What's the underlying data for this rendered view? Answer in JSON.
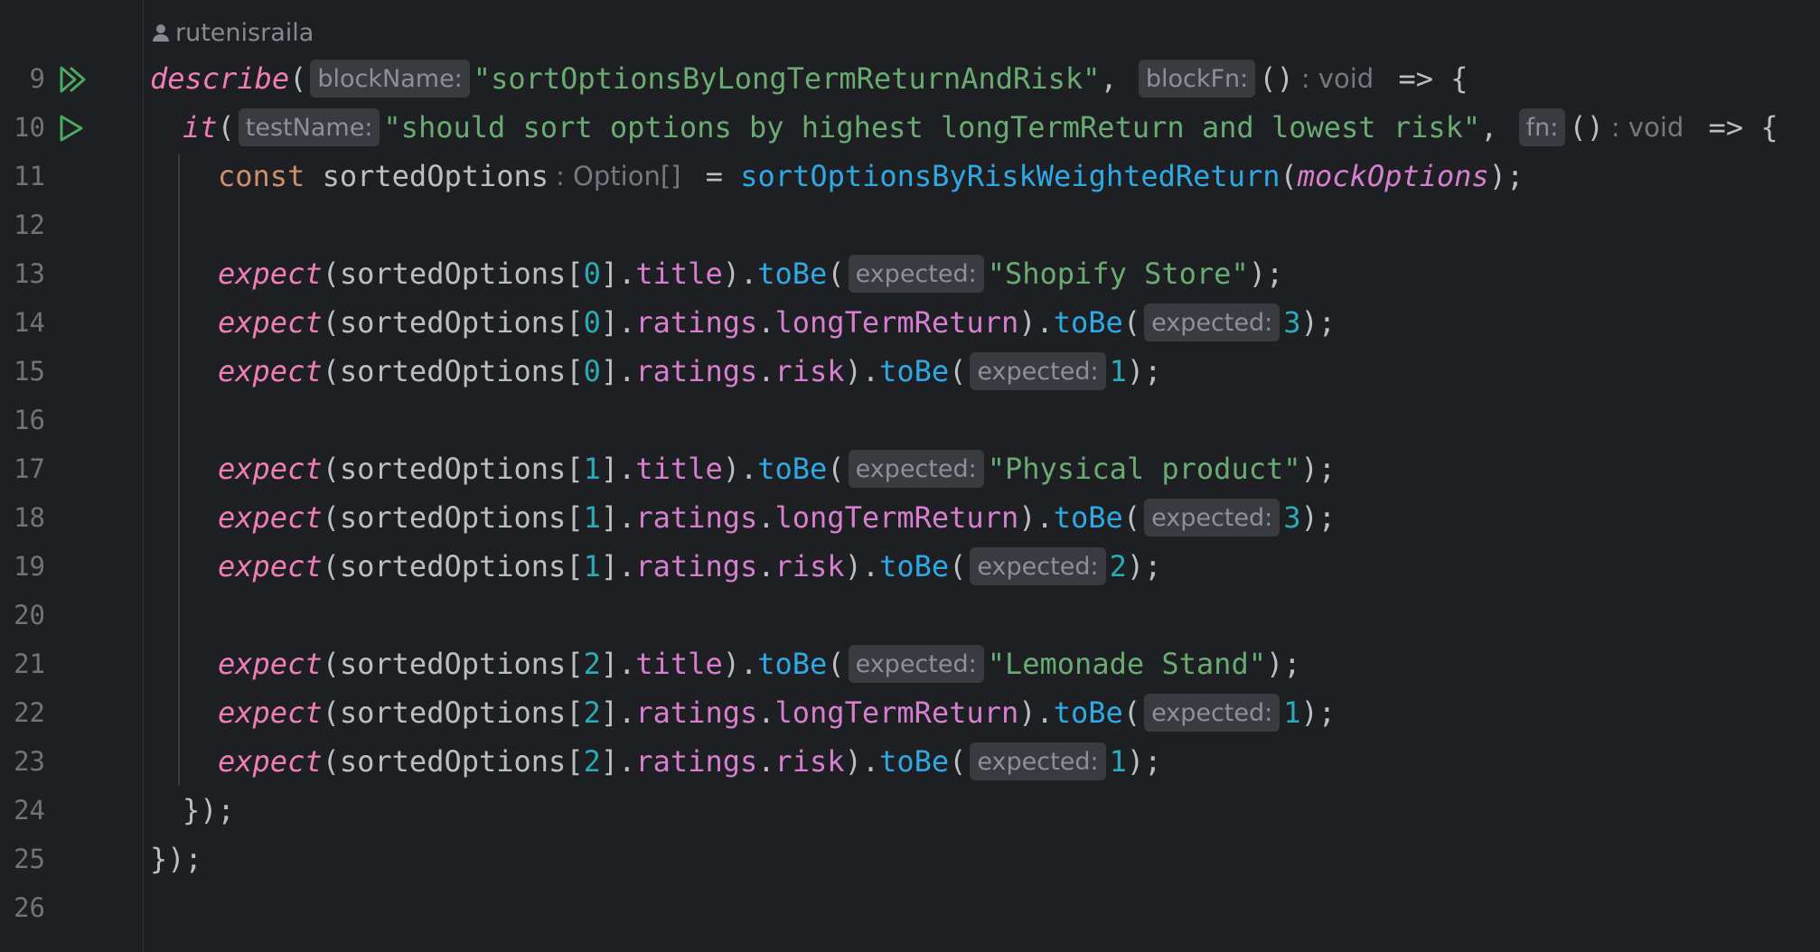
{
  "author": "rutenisraila",
  "lines": [
    {
      "n": "9"
    },
    {
      "n": "10"
    },
    {
      "n": "11"
    },
    {
      "n": "12"
    },
    {
      "n": "13"
    },
    {
      "n": "14"
    },
    {
      "n": "15"
    },
    {
      "n": "16"
    },
    {
      "n": "17"
    },
    {
      "n": "18"
    },
    {
      "n": "19"
    },
    {
      "n": "20"
    },
    {
      "n": "21"
    },
    {
      "n": "22"
    },
    {
      "n": "23"
    },
    {
      "n": "24"
    },
    {
      "n": "25"
    },
    {
      "n": "26"
    }
  ],
  "code": {
    "describe": "describe",
    "blockName_hint": "blockName:",
    "describe_name": "\"sortOptionsByLongTermReturnAndRisk\"",
    "blockFn_hint": "blockFn:",
    "void": ": void",
    "it": "it",
    "testName_hint": "testName:",
    "it_name": "\"should sort options by highest longTermReturn and lowest risk\"",
    "fn_hint": "fn:",
    "const": "const",
    "sortedOptions": "sortedOptions",
    "option_type": ": Option[]",
    "sort_fn": "sortOptionsByRiskWeightedReturn",
    "mockOptions": "mockOptions",
    "expect": "expect",
    "expected_hint": "expected:",
    "title": "title",
    "ratings": "ratings",
    "longTermReturn": "longTermReturn",
    "risk": "risk",
    "toBe": "toBe",
    "shopify": "\"Shopify Store\"",
    "physical": "\"Physical product\"",
    "lemonade": "\"Lemonade Stand\"",
    "i0": "0",
    "i1": "1",
    "i2": "2",
    "v3": "3",
    "v1": "1",
    "v2": "2"
  },
  "icons": {
    "run_all": "run-all-tests-icon",
    "run": "run-test-icon"
  }
}
